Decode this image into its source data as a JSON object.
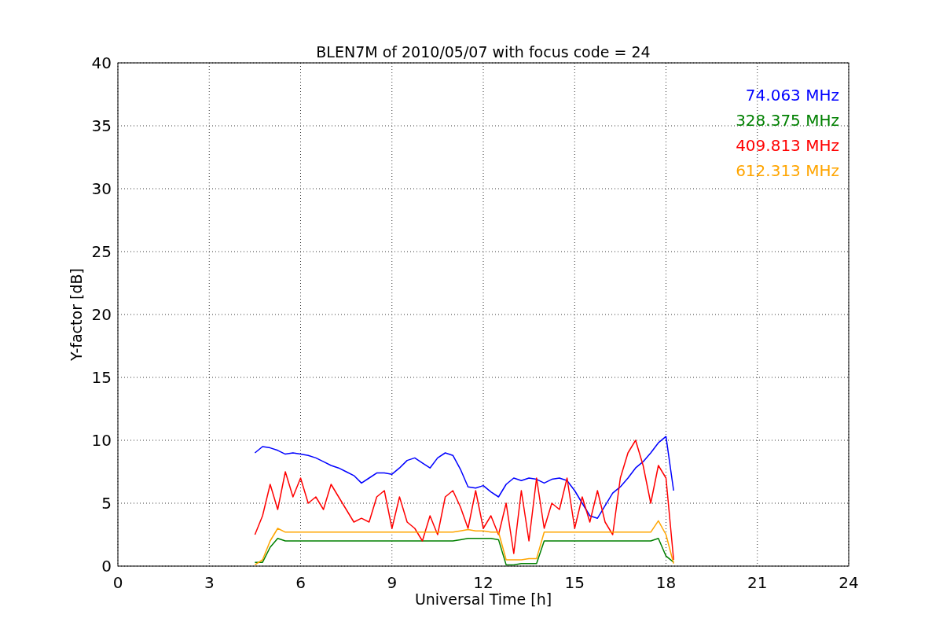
{
  "figure": {
    "chart_data": {
      "type": "line",
      "grid": true,
      "title": "BLEN7M of 2010/05/07 with focus code = 24",
      "xlabel": "Universal Time [h]",
      "ylabel": "Y-factor [dB]",
      "xlim": [
        0,
        24
      ],
      "ylim": [
        0,
        40
      ],
      "xticks": [
        0,
        3,
        6,
        9,
        12,
        15,
        18,
        21,
        24
      ],
      "yticks": [
        0,
        5,
        10,
        15,
        20,
        25,
        30,
        35,
        40
      ],
      "x": [
        4.5,
        4.75,
        5,
        5.25,
        5.5,
        5.75,
        6,
        6.25,
        6.5,
        6.75,
        7,
        7.25,
        7.5,
        7.75,
        8,
        8.25,
        8.5,
        8.75,
        9,
        9.25,
        9.5,
        9.75,
        10,
        10.25,
        10.5,
        10.75,
        11,
        11.25,
        11.5,
        11.75,
        12,
        12.25,
        12.5,
        12.75,
        13,
        13.25,
        13.5,
        13.75,
        14,
        14.25,
        14.5,
        14.75,
        15,
        15.25,
        15.5,
        15.75,
        16,
        16.25,
        16.5,
        16.75,
        17,
        17.25,
        17.5,
        17.75,
        18,
        18.25
      ],
      "series": [
        {
          "name": "74.063 MHz",
          "color": "#0000ff",
          "values": [
            9.0,
            9.5,
            9.4,
            9.2,
            8.9,
            9.0,
            8.9,
            8.8,
            8.6,
            8.3,
            8.0,
            7.8,
            7.5,
            7.2,
            6.6,
            7.0,
            7.4,
            7.4,
            7.3,
            7.8,
            8.4,
            8.6,
            8.2,
            7.8,
            8.6,
            9.0,
            8.8,
            7.7,
            6.3,
            6.2,
            6.4,
            5.9,
            5.5,
            6.5,
            7.0,
            6.8,
            7.0,
            6.9,
            6.6,
            6.9,
            7.0,
            6.8,
            6.0,
            5.0,
            4.0,
            3.8,
            4.8,
            5.8,
            6.3,
            7.0,
            7.8,
            8.3,
            9.0,
            9.8,
            10.3,
            6.0
          ]
        },
        {
          "name": "328.375 MHz",
          "color": "#008000",
          "values": [
            0.3,
            0.3,
            1.5,
            2.2,
            2.0,
            2.0,
            2.0,
            2.0,
            2.0,
            2.0,
            2.0,
            2.0,
            2.0,
            2.0,
            2.0,
            2.0,
            2.0,
            2.0,
            2.0,
            2.0,
            2.0,
            2.0,
            2.0,
            2.0,
            2.0,
            2.0,
            2.0,
            2.1,
            2.2,
            2.2,
            2.2,
            2.2,
            2.1,
            0.1,
            0.1,
            0.2,
            0.2,
            0.2,
            2.0,
            2.0,
            2.0,
            2.0,
            2.0,
            2.0,
            2.0,
            2.0,
            2.0,
            2.0,
            2.0,
            2.0,
            2.0,
            2.0,
            2.0,
            2.2,
            0.8,
            0.3
          ]
        },
        {
          "name": "409.813 MHz",
          "color": "#ff0000",
          "values": [
            2.5,
            4.0,
            6.5,
            4.5,
            7.5,
            5.5,
            7.0,
            5.0,
            5.5,
            4.5,
            6.5,
            5.5,
            4.5,
            3.5,
            3.8,
            3.5,
            5.5,
            6.0,
            3.0,
            5.5,
            3.5,
            3.0,
            2.0,
            4.0,
            2.5,
            5.5,
            6.0,
            4.7,
            3.0,
            6.0,
            3.0,
            4.0,
            2.5,
            5.0,
            1.0,
            6.0,
            2.0,
            7.0,
            3.0,
            5.0,
            4.5,
            7.0,
            3.0,
            5.5,
            3.5,
            6.0,
            3.5,
            2.5,
            7.0,
            9.0,
            10.0,
            8.0,
            5.0,
            8.0,
            7.0,
            0.5
          ]
        },
        {
          "name": "612.313 MHz",
          "color": "#ffa500",
          "values": [
            0.1,
            0.5,
            2.0,
            3.0,
            2.7,
            2.7,
            2.7,
            2.7,
            2.7,
            2.7,
            2.7,
            2.7,
            2.7,
            2.7,
            2.7,
            2.7,
            2.7,
            2.7,
            2.7,
            2.7,
            2.7,
            2.7,
            2.7,
            2.7,
            2.7,
            2.7,
            2.7,
            2.8,
            2.9,
            2.8,
            2.8,
            2.7,
            2.7,
            0.5,
            0.5,
            0.5,
            0.6,
            0.6,
            2.7,
            2.7,
            2.7,
            2.7,
            2.7,
            2.7,
            2.7,
            2.7,
            2.7,
            2.7,
            2.7,
            2.7,
            2.7,
            2.7,
            2.7,
            3.6,
            2.5,
            0.2
          ]
        }
      ]
    }
  }
}
